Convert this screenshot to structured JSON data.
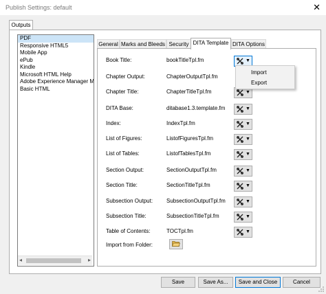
{
  "window": {
    "title": "Publish Settings: default"
  },
  "outer_tab": "Outputs",
  "outputs": [
    {
      "label": "PDF",
      "selected": true
    },
    {
      "label": "Responsive HTML5",
      "selected": false
    },
    {
      "label": "Mobile App",
      "selected": false
    },
    {
      "label": "ePub",
      "selected": false
    },
    {
      "label": "Kindle",
      "selected": false
    },
    {
      "label": "Microsoft HTML Help",
      "selected": false
    },
    {
      "label": "Adobe Experience Manager Mo",
      "selected": false
    },
    {
      "label": "Basic HTML",
      "selected": false
    }
  ],
  "tabs": [
    "General",
    "Marks and Bleeds",
    "Security",
    "DITA Template",
    "DITA Options"
  ],
  "active_tab": "DITA Template",
  "templates": [
    {
      "label": "Book Title:",
      "value": "bookTitleTpl.fm"
    },
    {
      "label": "Chapter Output:",
      "value": "ChapterOutputTpl.fm"
    },
    {
      "label": "Chapter Title:",
      "value": "ChapterTitleTpl.fm"
    },
    {
      "label": "DITA Base:",
      "value": "ditabase1.3.template.fm"
    },
    {
      "label": "Index:",
      "value": "IndexTpl.fm"
    },
    {
      "label": "List of Figures:",
      "value": "ListofFiguresTpl.fm"
    },
    {
      "label": "List of Tables:",
      "value": "ListofTablesTpl.fm"
    },
    {
      "label": "Section Output:",
      "value": "SectionOutputTpl.fm"
    },
    {
      "label": "Section Title:",
      "value": "SectionTitleTpl.fm"
    },
    {
      "label": "Subsection Output:",
      "value": "SubsectionOutputTpl.fm"
    },
    {
      "label": "Subsection Title:",
      "value": "SubsectionTitleTpl.fm"
    },
    {
      "label": "Table of Contents:",
      "value": "TOCTpl.fm"
    }
  ],
  "import_folder_label": "Import from Folder:",
  "menu": [
    "Import",
    "Export"
  ],
  "buttons": {
    "save": "Save",
    "save_as": "Save As...",
    "save_close": "Save and Close",
    "cancel": "Cancel"
  },
  "icons": {
    "close": "close-icon",
    "tool": "tools-icon",
    "folder": "folder-open-icon"
  },
  "colors": {
    "selection": "#cce4f7",
    "focus_border": "#0078d7"
  }
}
